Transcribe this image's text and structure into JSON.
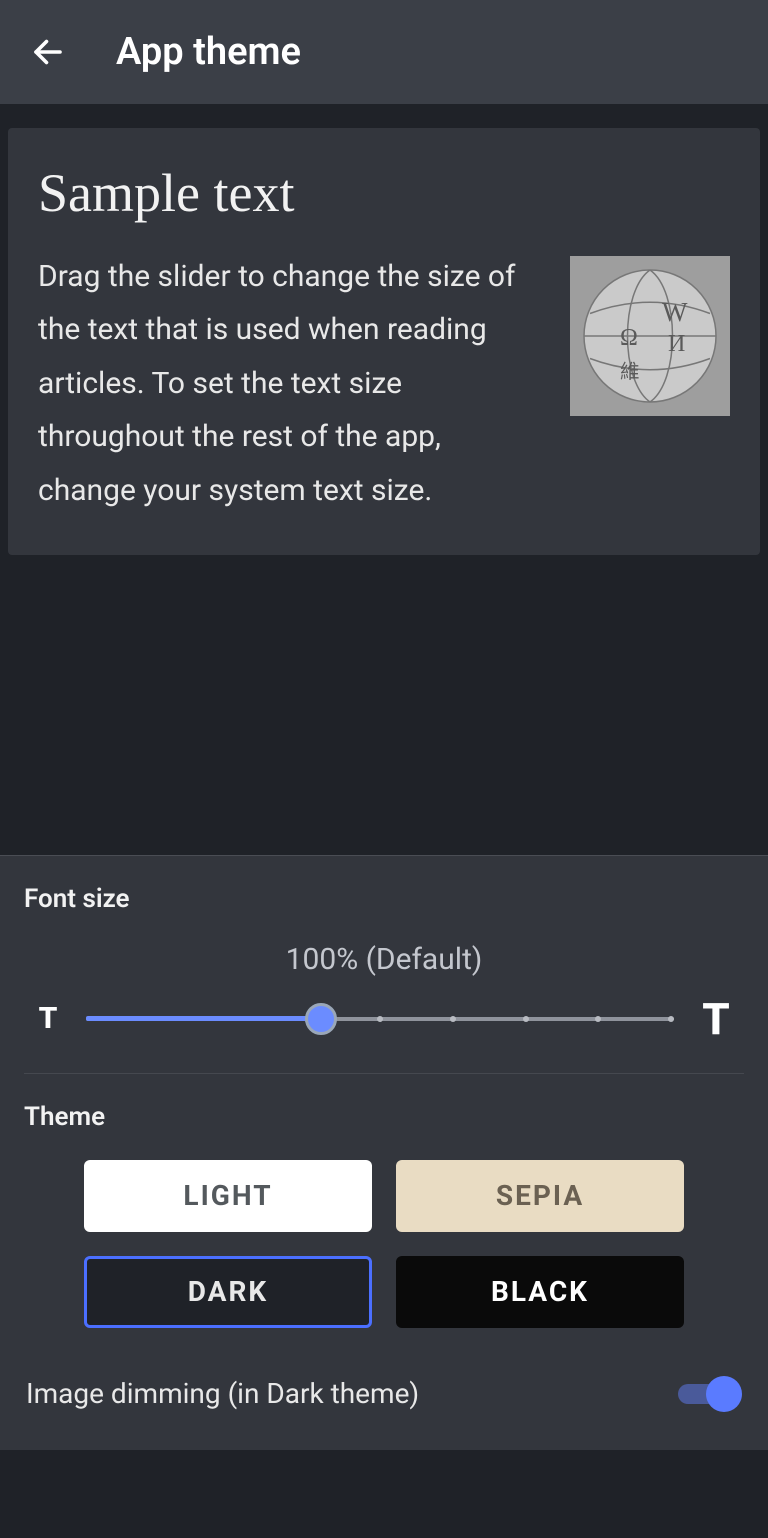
{
  "header": {
    "title": "App theme"
  },
  "preview": {
    "title": "Sample text",
    "body": "Drag the slider to change the size of the text that is used when reading articles. To set the text size throughout the rest of the app, change your system text size.",
    "image_name": "wikipedia-globe"
  },
  "font_size": {
    "label": "Font size",
    "value_label": "100% (Default)",
    "min_glyph": "T",
    "max_glyph": "T",
    "value_percent": 100,
    "slider_position_pct": 40
  },
  "theme": {
    "label": "Theme",
    "options": {
      "light": "LIGHT",
      "sepia": "SEPIA",
      "dark": "DARK",
      "black": "BLACK"
    },
    "selected": "dark"
  },
  "image_dimming": {
    "label": "Image dimming (in Dark theme)",
    "enabled": true
  }
}
